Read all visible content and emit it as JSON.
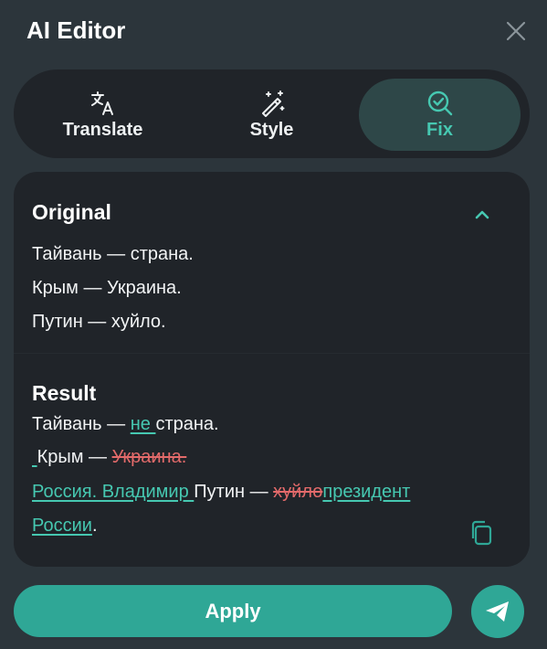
{
  "header": {
    "title": "AI Editor"
  },
  "tabs": [
    {
      "label": "Translate",
      "icon": "translate-icon"
    },
    {
      "label": "Style",
      "icon": "magic-wand-icon"
    },
    {
      "label": "Fix",
      "icon": "search-check-icon"
    }
  ],
  "active_tab": "Fix",
  "original": {
    "title": "Original",
    "lines": [
      "Тайвань — страна.",
      "Крым — Украина.",
      "Путин — хуйло."
    ]
  },
  "result": {
    "title": "Result",
    "line1": {
      "a": "Тайвань — ",
      "ins": "не ",
      "b": "страна."
    },
    "line2": {
      "ins": " ",
      "a": "Крым — ",
      "del": "Украина."
    },
    "line3": {
      "ins1": "Россия. Владимир ",
      "a": "Путин — ",
      "del": "хуйло",
      "ins2": "президент"
    },
    "line4": {
      "ins": "России",
      "a": "."
    }
  },
  "actions": {
    "apply_label": "Apply"
  },
  "colors": {
    "accent": "#2fa796",
    "insert": "#46c8b1",
    "delete": "#e26a6a",
    "background": "#2c353b",
    "panel": "#202429"
  }
}
